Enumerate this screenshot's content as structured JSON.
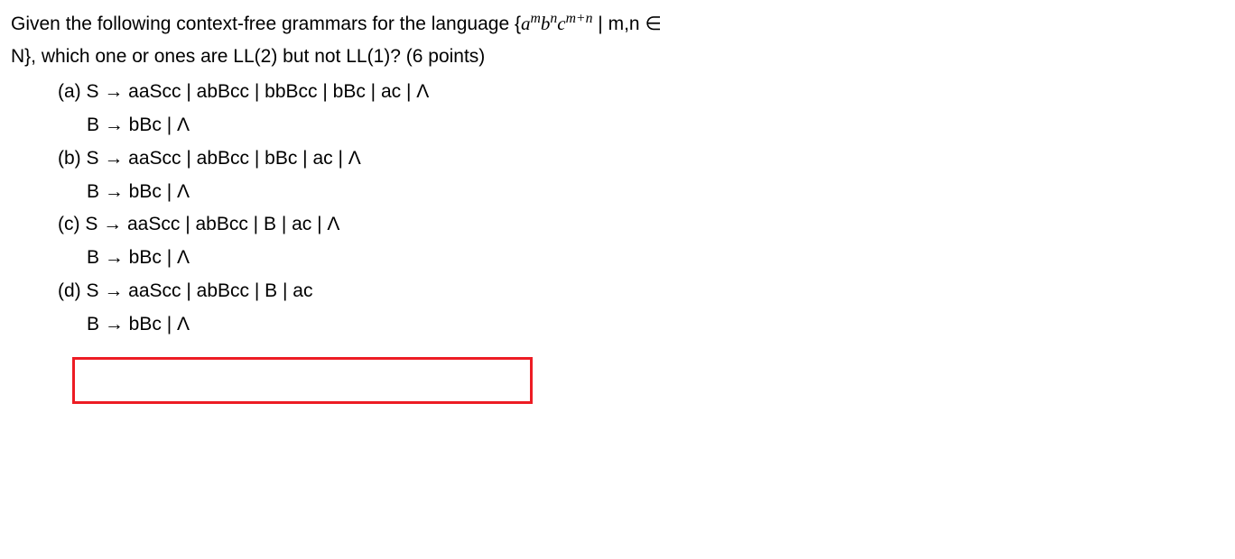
{
  "question": {
    "line1_prefix": "Given the following context-free grammars for the language {",
    "expr_a": "a",
    "expr_m": "m",
    "expr_b": "b",
    "expr_n": "n",
    "expr_c": "c",
    "expr_mn": "m+n",
    "line1_suffix_space": "  ",
    "line1_bar": "| m,n ",
    "line1_in": "∈",
    "line2": "N}, which one or ones are LL(2) but not LL(1)?   (6 points)"
  },
  "options": {
    "a": {
      "main": "(a) S → aaScc | abBcc | bbBcc | bBc | ac | Λ",
      "sub": "B → bBc | Λ"
    },
    "b": {
      "main": "(b) S → aaScc | abBcc | bBc | ac | Λ",
      "sub": "B → bBc | Λ"
    },
    "c": {
      "main": "(c) S → aaScc | abBcc | B | ac | Λ",
      "sub": "B → bBc | Λ"
    },
    "d": {
      "main": "(d) S → aaScc | abBcc | B | ac",
      "sub": "B → bBc | Λ"
    }
  }
}
